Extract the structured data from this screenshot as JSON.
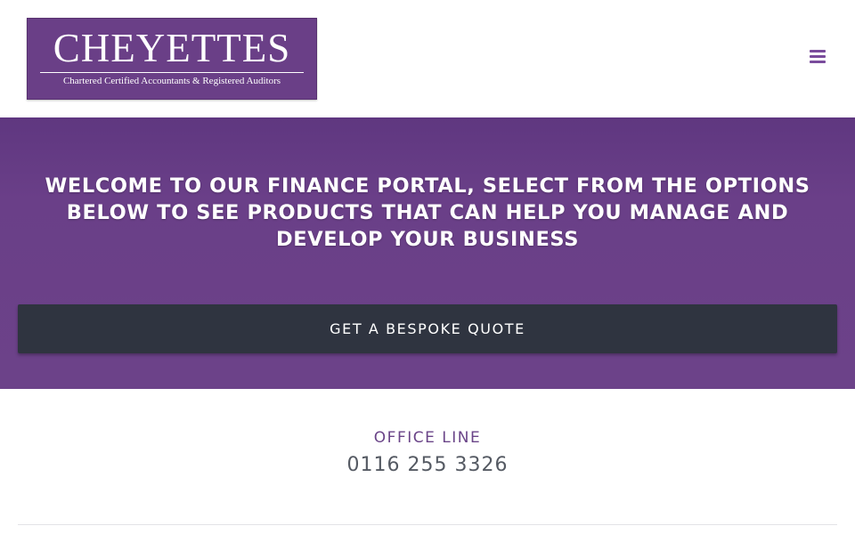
{
  "header": {
    "logo": {
      "name": "CHEYETTES",
      "tagline": "Chartered Certified Accountants & Registered Auditors"
    },
    "menu_icon": "hamburger-menu-icon"
  },
  "hero": {
    "heading": "WELCOME TO OUR FINANCE PORTAL, SELECT FROM THE OPTIONS BELOW TO SEE PRODUCTS THAT CAN HELP YOU MANAGE AND DEVELOP YOUR BUSINESS",
    "button_label": "GET A BESPOKE QUOTE"
  },
  "contact": {
    "label": "OFFICE LINE",
    "phone": "0116 255 3326"
  },
  "colors": {
    "brand_purple": "#6a3f87",
    "button_dark": "#2f3440",
    "menu_icon": "#7a4c9c"
  }
}
